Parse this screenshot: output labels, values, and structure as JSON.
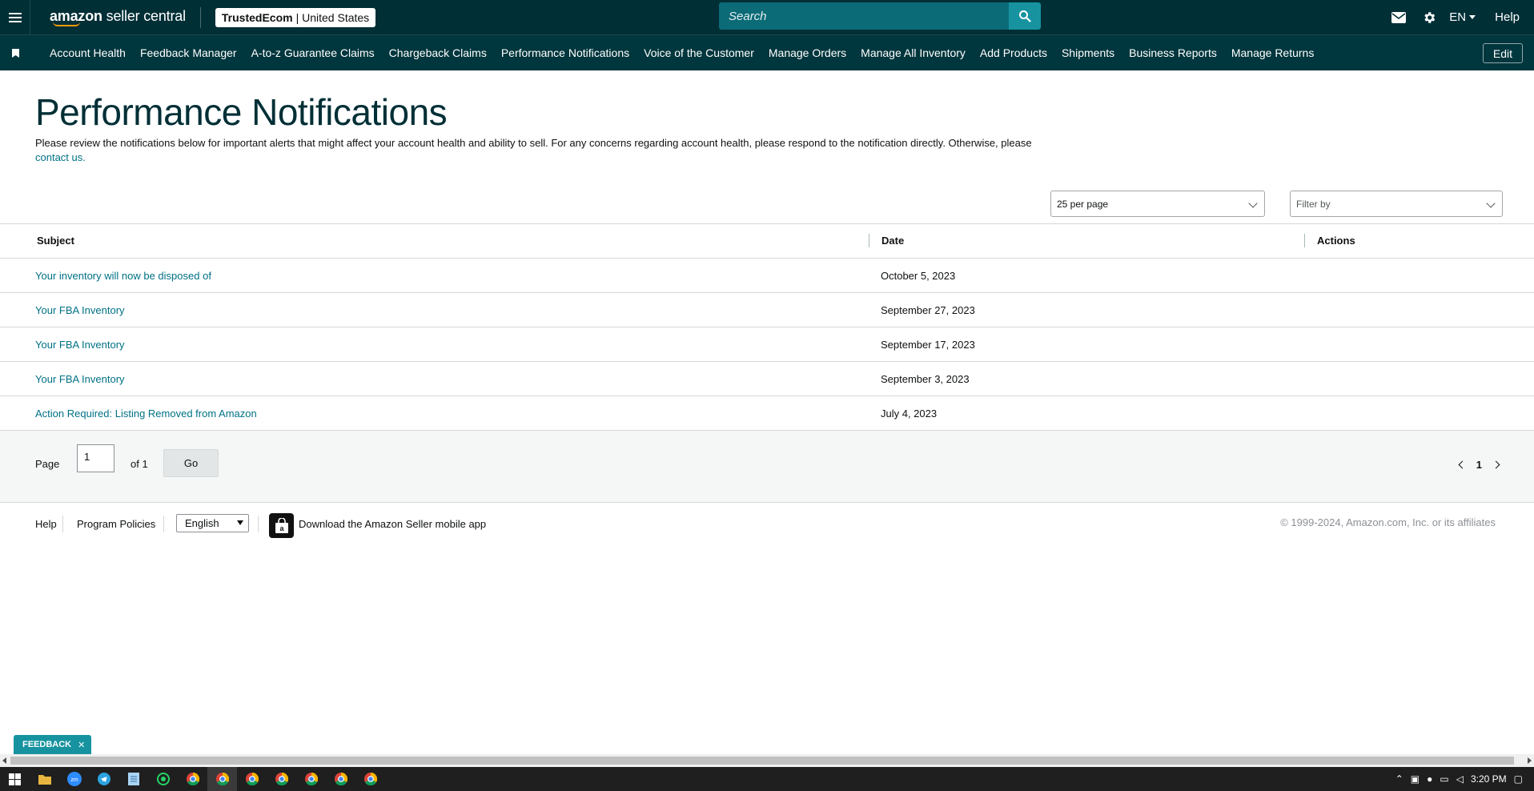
{
  "header": {
    "logo_brand": "amazon",
    "logo_product": "seller central",
    "store_name": "TrustedEcom",
    "store_marketplace": "| United States",
    "search_placeholder": "Search",
    "language": "EN",
    "help_label": "Help"
  },
  "nav": {
    "items": [
      "Account Health",
      "Feedback Manager",
      "A-to-z Guarantee Claims",
      "Chargeback Claims",
      "Performance Notifications",
      "Voice of the Customer",
      "Manage Orders",
      "Manage All Inventory",
      "Add Products",
      "Shipments",
      "Business Reports",
      "Manage Returns"
    ],
    "edit_label": "Edit"
  },
  "main": {
    "title": "Performance Notifications",
    "intro_text": "Please review the notifications below for important alerts that might affect your account health and ability to sell. For any concerns regarding account health, please respond to the notification directly. Otherwise, please",
    "contact_link": "contact us.",
    "per_page_value": "25 per page",
    "filter_placeholder": "Filter by"
  },
  "table": {
    "headers": {
      "subject": "Subject",
      "date": "Date",
      "actions": "Actions"
    },
    "rows": [
      {
        "subject": "Your inventory will now be disposed of",
        "date": "October 5, 2023"
      },
      {
        "subject": "Your FBA Inventory",
        "date": "September 27, 2023"
      },
      {
        "subject": "Your FBA Inventory",
        "date": "September 17, 2023"
      },
      {
        "subject": "Your FBA Inventory",
        "date": "September 3, 2023"
      },
      {
        "subject": "Action Required: Listing Removed from Amazon",
        "date": "July 4, 2023"
      }
    ]
  },
  "pagination": {
    "page_label": "Page",
    "page_value": "1",
    "of_label": "of 1",
    "go_label": "Go",
    "current_page": "1"
  },
  "footer": {
    "help": "Help",
    "program_policies": "Program Policies",
    "language_value": "English",
    "app_download": "Download the Amazon Seller mobile app",
    "copyright": "© 1999-2024, Amazon.com, Inc. or its affiliates"
  },
  "feedback_label": "FEEDBACK",
  "taskbar": {
    "time": "3:20 PM",
    "zm_label": "zm"
  },
  "colors": {
    "topbar": "#002f36",
    "navbar": "#00363d",
    "link": "#007185",
    "accent": "#1793a0",
    "search": "#0b6b77",
    "smile": "#ff9900"
  }
}
